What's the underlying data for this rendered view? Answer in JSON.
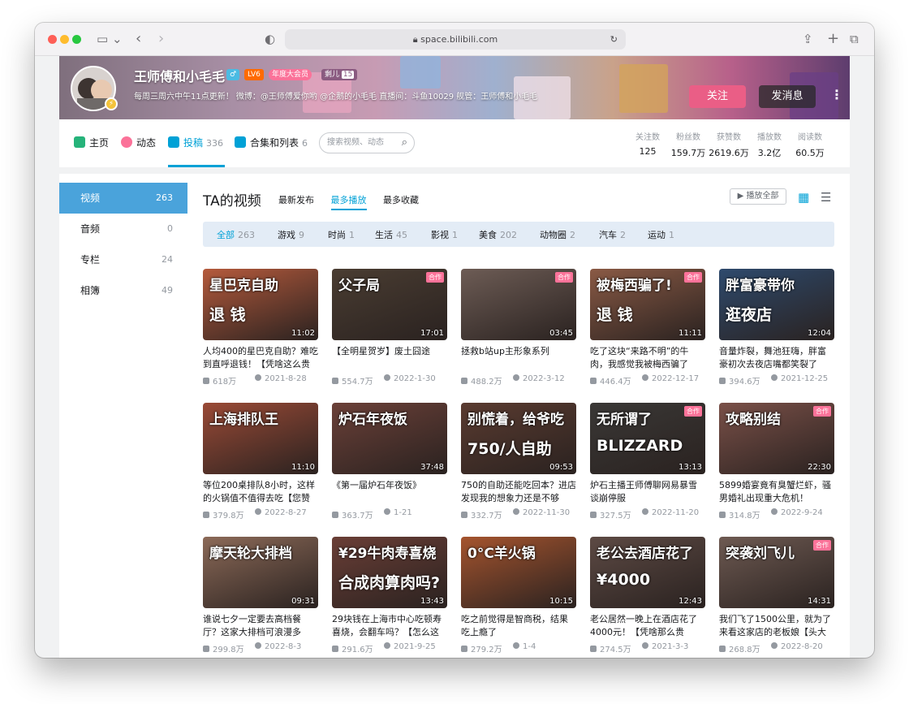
{
  "browser": {
    "url": "space.bilibili.com"
  },
  "profile": {
    "name": "王师傅和小毛毛",
    "level": "LV6",
    "vip": "年度大会员",
    "badge": "剩儿",
    "badge_count": "15",
    "sign": "每周三周六中午11点更新！ 微博：@王师傅爱你哟 @企鹅的小毛毛 直播间：斗鱼10029 舰管：王师傅和小毛毛",
    "follow_button": "关注",
    "message_button": "发消息"
  },
  "nav": {
    "home": "主页",
    "dynamic": "动态",
    "uploads": "投稿",
    "uploads_count": "336",
    "collections": "合集和列表",
    "collections_count": "6",
    "search_placeholder": "搜索视频、动态"
  },
  "stats": [
    {
      "label": "关注数",
      "value": "125"
    },
    {
      "label": "粉丝数",
      "value": "159.7万"
    },
    {
      "label": "获赞数",
      "value": "2619.6万"
    },
    {
      "label": "播放数",
      "value": "3.2亿"
    },
    {
      "label": "阅读数",
      "value": "60.5万"
    }
  ],
  "sidebar": [
    {
      "label": "视频",
      "count": "263"
    },
    {
      "label": "音频",
      "count": "0"
    },
    {
      "label": "专栏",
      "count": "24"
    },
    {
      "label": "相簿",
      "count": "49"
    }
  ],
  "content": {
    "title": "TA的视频",
    "sort": [
      "最新发布",
      "最多播放",
      "最多收藏"
    ],
    "play_all": "播放全部"
  },
  "filters": [
    {
      "label": "全部",
      "count": "263"
    },
    {
      "label": "游戏",
      "count": "9"
    },
    {
      "label": "时尚",
      "count": "1"
    },
    {
      "label": "生活",
      "count": "45"
    },
    {
      "label": "影视",
      "count": "1"
    },
    {
      "label": "美食",
      "count": "202"
    },
    {
      "label": "动物圈",
      "count": "2"
    },
    {
      "label": "汽车",
      "count": "2"
    },
    {
      "label": "运动",
      "count": "1"
    }
  ],
  "coop_label": "合作",
  "videos": [
    {
      "thumb": "星巴克自助",
      "thumb2": "退 钱",
      "duration": "11:02",
      "title": "人均400的星巴克自助？难吃到直呼退钱！【凭啥这么贵",
      "plays": "618万",
      "date": "2021-8-28",
      "color": "#b55a3c"
    },
    {
      "thumb": "父子局",
      "thumb2": "",
      "duration": "17:01",
      "title": "【全明星贺岁】废土囧途",
      "plays": "554.7万",
      "date": "2022-1-30",
      "color": "#4a3d32"
    },
    {
      "thumb": "",
      "thumb2": "",
      "duration": "03:45",
      "title": "拯救b站up主形象系列",
      "plays": "488.2万",
      "date": "2022-3-12",
      "color": "#6d5c55"
    },
    {
      "thumb": "被梅西骗了!",
      "thumb2": "退 钱",
      "duration": "11:11",
      "title": "吃了这块“来路不明”的牛肉，我感觉我被梅西骗了【凭啥这",
      "plays": "446.4万",
      "date": "2022-12-17",
      "color": "#8a5a45"
    },
    {
      "thumb": "胖富豪带你",
      "thumb2": "逛夜店",
      "duration": "12:04",
      "title": "音量炸裂，舞池狂嗨，胖富豪初次去夜店嘴都笑裂了【还债",
      "plays": "394.6万",
      "date": "2021-12-25",
      "color": "#2e4a6d"
    },
    {
      "thumb": "上海排队王",
      "thumb2": "",
      "duration": "11:10",
      "title": "等位200桌排队8小时，这样的火锅值不值得去吃【您赞我",
      "plays": "379.8万",
      "date": "2022-8-27",
      "color": "#9a4a36"
    },
    {
      "thumb": "炉石年夜饭",
      "thumb2": "",
      "duration": "37:48",
      "title": "《第一届炉石年夜饭》",
      "plays": "363.7万",
      "date": "1-21",
      "color": "#6b4038"
    },
    {
      "thumb": "别慌着，给爷吃",
      "thumb2": "750/人自助",
      "duration": "09:53",
      "title": "750的自助还能吃回本？进店发现我的想象力还是不够【凭",
      "plays": "332.7万",
      "date": "2022-11-30",
      "color": "#5a3b30"
    },
    {
      "thumb": "无所谓了",
      "thumb2": "BLIZZARD",
      "duration": "13:13",
      "title": "炉石主播王师傅聊网易暴雪谈崩停服",
      "plays": "327.5万",
      "date": "2022-11-20",
      "color": "#3a3836"
    },
    {
      "thumb": "攻略别结",
      "thumb2": "",
      "duration": "22:30",
      "title": "5899婚宴竟有臭蟹烂虾，骚男婚礼出现重大危机！",
      "plays": "314.8万",
      "date": "2022-9-24",
      "color": "#7a5048"
    },
    {
      "thumb": "摩天轮大排档",
      "thumb2": "",
      "duration": "09:31",
      "title": "谁说七夕一定要去高档餐厅？这家大排档可浪漫多了！",
      "plays": "299.8万",
      "date": "2022-8-3",
      "color": "#8c6a58"
    },
    {
      "thumb": "¥29牛肉寿喜烧",
      "thumb2": "合成肉算肉吗?",
      "duration": "13:43",
      "title": "29块钱在上海市中心吃顿寿喜烧，会翻车吗？【怎么这么",
      "plays": "291.6万",
      "date": "2021-9-25",
      "color": "#6a3e36"
    },
    {
      "thumb": "0°C羊火锅",
      "thumb2": "",
      "duration": "10:15",
      "title": "吃之前觉得是智商税，结果吃上瘾了",
      "plays": "279.2万",
      "date": "1-4",
      "color": "#a5542e"
    },
    {
      "thumb": "老公去酒店花了",
      "thumb2": "¥4000",
      "duration": "12:43",
      "title": "老公居然一晚上在酒店花了4000元！【凭啥那么贵",
      "plays": "274.5万",
      "date": "2021-3-3",
      "color": "#5d4a44"
    },
    {
      "thumb": "突袭刘飞儿",
      "thumb2": "",
      "duration": "14:31",
      "title": "我们飞了1500公里，就为了来看这家店的老板娘【头大挑",
      "plays": "268.8万",
      "date": "2022-8-20",
      "color": "#6e5a52"
    }
  ],
  "coop": [
    false,
    true,
    true,
    true,
    false,
    false,
    false,
    false,
    true,
    true,
    false,
    false,
    false,
    false,
    true
  ]
}
